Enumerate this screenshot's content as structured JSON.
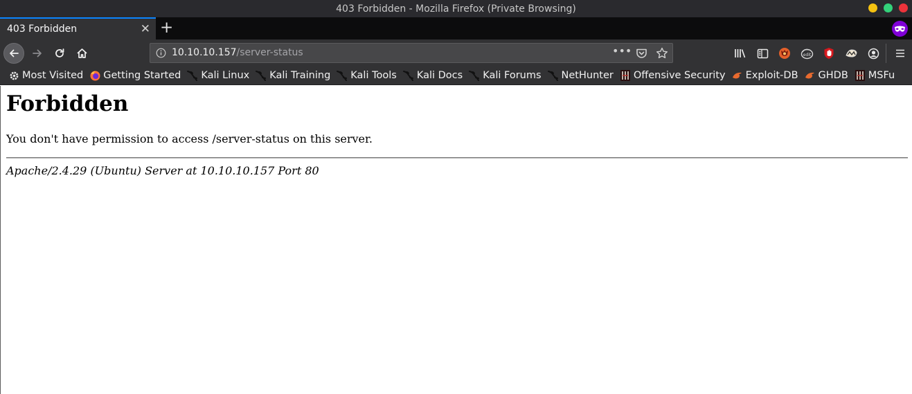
{
  "window": {
    "title": "403 Forbidden - Mozilla Firefox (Private Browsing)",
    "controls": [
      "minimize",
      "maximize",
      "close"
    ],
    "control_colors": {
      "minimize": "#f5c211",
      "maximize": "#33d17a",
      "close": "#ed333b"
    }
  },
  "tabs": [
    {
      "label": "403 Forbidden",
      "active": true
    }
  ],
  "toolbar": {
    "url_host": "10.10.10.157",
    "url_path": "/server-status",
    "icons": [
      "back-icon",
      "forward-icon",
      "reload-icon",
      "home-icon",
      "info-icon",
      "page-actions-icon",
      "pocket-icon",
      "bookmark-star-icon",
      "library-icon",
      "sidebar-icon",
      "foxyproxy-icon",
      "cookie-icon",
      "ublock-icon",
      "wappalyzer-icon",
      "account-icon",
      "menu-icon"
    ]
  },
  "bookmarks": [
    {
      "label": "Most Visited",
      "icon": "gear-icon"
    },
    {
      "label": "Getting Started",
      "icon": "firefox-icon"
    },
    {
      "label": "Kali Linux",
      "icon": "kali-dragon-icon"
    },
    {
      "label": "Kali Training",
      "icon": "kali-dragon-icon"
    },
    {
      "label": "Kali Tools",
      "icon": "kali-dragon-icon"
    },
    {
      "label": "Kali Docs",
      "icon": "kali-dragon-icon"
    },
    {
      "label": "Kali Forums",
      "icon": "kali-dragon-icon"
    },
    {
      "label": "NetHunter",
      "icon": "kali-dragon-icon"
    },
    {
      "label": "Offensive Security",
      "icon": "offsec-icon"
    },
    {
      "label": "Exploit-DB",
      "icon": "exploitdb-icon"
    },
    {
      "label": "GHDB",
      "icon": "exploitdb-icon"
    },
    {
      "label": "MSFu",
      "icon": "offsec-icon"
    }
  ],
  "page": {
    "heading": "Forbidden",
    "message": "You don't have permission to access /server-status on this server.",
    "signature": "Apache/2.4.29 (Ubuntu) Server at 10.10.10.157 Port 80"
  },
  "colors": {
    "accent": "#0a84ff",
    "private_browsing": "#8000d7",
    "chrome_dark": "#323234"
  }
}
